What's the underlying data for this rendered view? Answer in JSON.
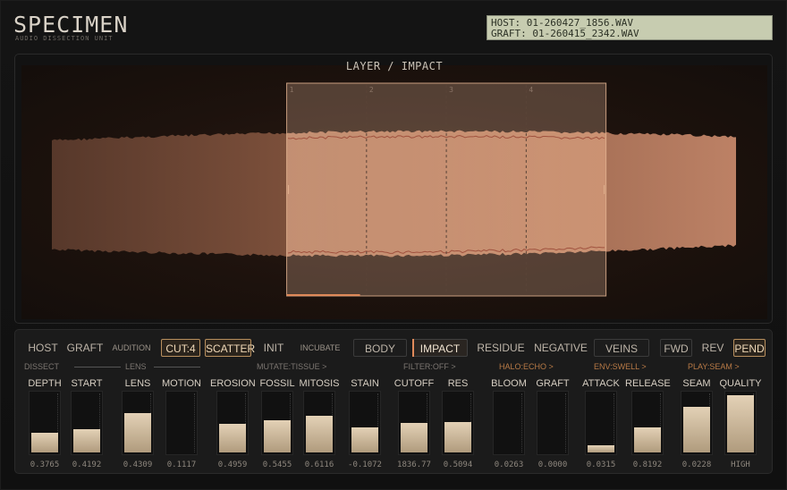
{
  "header": {
    "logo": "SPECIMEN",
    "subtitle": "AUDIO DISSECTION UNIT",
    "display": {
      "host": "HOST:  01-260427_1856.WAV",
      "graft": "GRAFT: 01-260415_2342.WAV"
    }
  },
  "wave": {
    "title": "LAYER / IMPACT",
    "slice_numbers": [
      "1",
      "2",
      "3",
      "4"
    ],
    "selection": {
      "start": 0.395,
      "end": 0.835
    },
    "colors": {
      "body": "#8c5a42",
      "highlight": "#d39673",
      "frame": "#e0b18f"
    }
  },
  "toolbar": {
    "host": "HOST",
    "graft": "GRAFT",
    "audition": "AUDITION",
    "cut": "CUT:4",
    "scatter": "SCATTER",
    "init": "INIT",
    "incubate": "INCUBATE",
    "body": "BODY",
    "impact": "IMPACT",
    "residue": "RESIDUE",
    "negative": "NEGATIVE",
    "veins": "VEINS",
    "fwd": "FWD",
    "rev": "REV",
    "pend": "PEND"
  },
  "sections": {
    "dissect": "DISSECT",
    "lens": "LENS",
    "mutate": "MUTATE:TISSUE >",
    "filter": "FILTER:OFF >",
    "halo": "HALO:ECHO >",
    "env": "ENV:SWELL >",
    "play": "PLAY:SEAM >"
  },
  "params": [
    {
      "label": "DEPTH",
      "value": "0.3765",
      "level": 0.34
    },
    {
      "label": "START",
      "value": "0.4192",
      "level": 0.4
    },
    {
      "label": "LENS",
      "value": "0.4309",
      "level": 0.66
    },
    {
      "label": "MOTION",
      "value": "0.1117",
      "level": 0.0
    },
    {
      "label": "EROSION",
      "value": "0.4959",
      "level": 0.49
    },
    {
      "label": "FOSSIL",
      "value": "0.5455",
      "level": 0.55
    },
    {
      "label": "MITOSIS",
      "value": "0.6116",
      "level": 0.62
    },
    {
      "label": "STAIN",
      "value": "-0.1072",
      "level": 0.42
    },
    {
      "label": "CUTOFF",
      "value": "1836.77",
      "level": 0.5
    },
    {
      "label": "RES",
      "value": "0.5094",
      "level": 0.51
    },
    {
      "label": "BLOOM",
      "value": "0.0263",
      "level": 0.0
    },
    {
      "label": "GRAFT",
      "value": "0.0000",
      "level": 0.0
    },
    {
      "label": "ATTACK",
      "value": "0.0315",
      "level": 0.12
    },
    {
      "label": "RELEASE",
      "value": "0.8192",
      "level": 0.42
    },
    {
      "label": "SEAM",
      "value": "0.0228",
      "level": 0.77
    },
    {
      "label": "QUALITY",
      "value": "HIGH",
      "level": 0.97
    }
  ]
}
